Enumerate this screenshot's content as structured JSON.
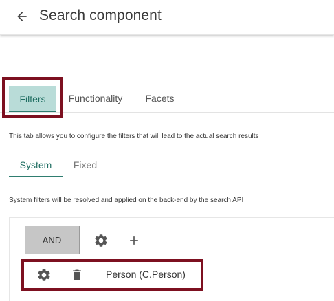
{
  "header": {
    "back_icon": "arrow-left-icon",
    "title": "Search component"
  },
  "tabs": [
    {
      "label": "Filters",
      "active": true
    },
    {
      "label": "Functionality",
      "active": false
    },
    {
      "label": "Facets",
      "active": false
    }
  ],
  "tab_description": "This tab allows you to configure the filters that will lead to the actual search results",
  "subtabs": [
    {
      "label": "System",
      "active": true
    },
    {
      "label": "Fixed",
      "active": false
    }
  ],
  "system_description": "System filters will be resolved and applied on the back-end by the search API",
  "filter_group": {
    "operator_label": "AND",
    "settings_icon": "gear-icon",
    "add_icon": "plus-icon",
    "rows": [
      {
        "settings_icon": "gear-icon",
        "delete_icon": "trash-icon",
        "label": "Person (C.Person)"
      }
    ]
  },
  "colors": {
    "accent": "#2f7d70",
    "active_tab_bg": "#b9dcd8",
    "highlight": "#7d1020",
    "operator_bg": "#c6c6c6"
  }
}
